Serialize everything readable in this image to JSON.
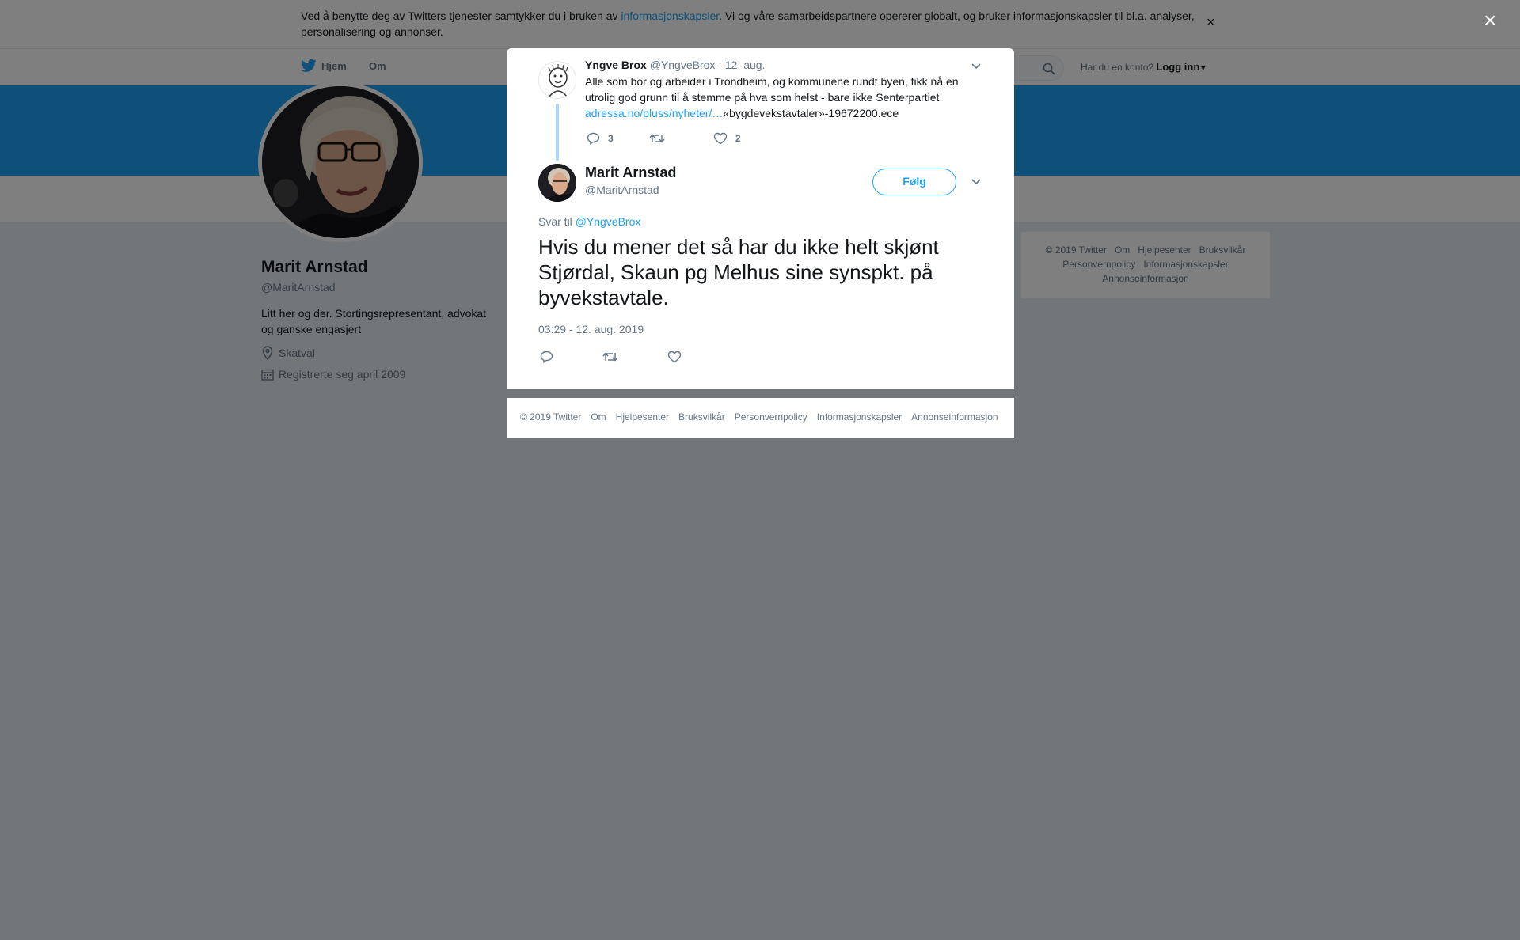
{
  "cookie_banner": {
    "text_before": "Ved å benytte deg av Twitters tjenester samtykker du i bruken av ",
    "link": "informasjonskapsler",
    "text_after": ". Vi og våre samarbeidspartnere opererer globalt, og bruker informasjonskapsler til bl.a. analyser, personalisering og annonser.",
    "close": "×"
  },
  "nav": {
    "home": "Hjem",
    "about": "Om",
    "account_prompt": "Har du en konto?",
    "login": "Logg inn"
  },
  "profile": {
    "name": "Marit Arnstad",
    "handle": "@MaritArnstad",
    "bio": "Litt her og der. Stortingsrepresentant, advokat og ganske engasjert",
    "location": "Skatval",
    "joined": "Registrerte seg april 2009"
  },
  "side_footer": {
    "items": [
      "© 2019 Twitter",
      "Om",
      "Hjelpesenter",
      "Bruksvilkår",
      "Personvernpolicy",
      "Informasjonskapsler",
      "Annonseinformasjon"
    ]
  },
  "modal": {
    "close": "×",
    "parent_tweet": {
      "name": "Yngve Brox",
      "handle": "@YngveBrox",
      "date": "· 12. aug.",
      "text": "Alle som bor og arbeider i Trondheim, og kommunene rundt byen, fikk nå en utrolig god grunn til å stemme på hva som helst - bare ikke Senterpartiet.",
      "link": "adressa.no/pluss/nyheter/…",
      "link_tail": "«bygdevekstavtaler»-19672200.ece",
      "replies": "3",
      "retweets": "",
      "likes": "2"
    },
    "tweet": {
      "name": "Marit Arnstad",
      "handle": "@MaritArnstad",
      "follow": "Følg",
      "reply_to_label": "Svar til ",
      "reply_to_handle": "@YngveBrox",
      "text": "Hvis du mener det så har du ikke helt skjønt Stjørdal, Skaun pg Melhus sine synspkt. på byvekstavtale.",
      "timestamp": "03:29 - 12. aug. 2019"
    },
    "footer": {
      "items": [
        "© 2019 Twitter",
        "Om",
        "Hjelpesenter",
        "Bruksvilkår",
        "Personvernpolicy",
        "Informasjonskapsler",
        "Annonseinformasjon"
      ]
    }
  },
  "colors": {
    "brand": "#1da1f2",
    "thread_line": "#aad8f5",
    "overlay": "rgba(0,0,0,0.5)"
  }
}
